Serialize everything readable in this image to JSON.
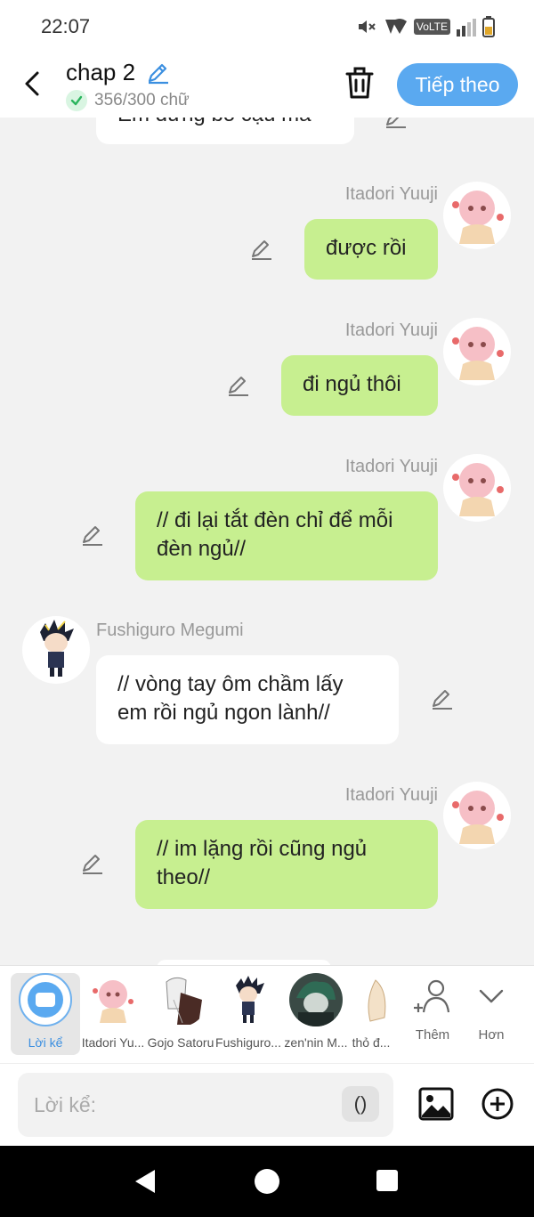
{
  "status_bar": {
    "time": "22:07",
    "network": "VoLTE"
  },
  "header": {
    "title": "chap 2",
    "word_count": "356/300 chữ",
    "next_label": "Tiếp theo"
  },
  "messages": [
    {
      "side": "left",
      "sender": "",
      "text": "Em đừng bỏ cậu mà"
    },
    {
      "side": "right",
      "sender": "Itadori Yuuji",
      "text": "được rồi"
    },
    {
      "side": "right",
      "sender": "Itadori Yuuji",
      "text": "đi ngủ thôi"
    },
    {
      "side": "right",
      "sender": "Itadori Yuuji",
      "text": "// đi lại tắt đèn chỉ để mỗi đèn ngủ//"
    },
    {
      "side": "left",
      "sender": "Fushiguro Megumi",
      "text": "// vòng tay ôm chầm lấy em rồi ngủ ngon lành//"
    },
    {
      "side": "right",
      "sender": "Itadori Yuuji",
      "text": "// im lặng rồi cũng ngủ theo//"
    }
  ],
  "characters": [
    {
      "label": "Lời kể",
      "icon": "narration-icon",
      "selected": true
    },
    {
      "label": "Itadori Yu...",
      "icon": "itadori-avatar"
    },
    {
      "label": "Gojo Satoru",
      "icon": "gojo-avatar"
    },
    {
      "label": "Fushiguro...",
      "icon": "fushiguro-avatar"
    },
    {
      "label": "zen'nin M...",
      "icon": "zenin-avatar"
    },
    {
      "label": "thỏ đ...",
      "icon": "tho-avatar"
    }
  ],
  "tools": {
    "add_label": "Thêm",
    "more_label": "Hơn"
  },
  "input": {
    "placeholder": "Lời kể:",
    "paren_label": "()"
  },
  "colors": {
    "accent": "#5aa9f0",
    "my_bubble": "#c7ef90",
    "other_bubble": "#ffffff",
    "background": "#f2f2f2"
  }
}
